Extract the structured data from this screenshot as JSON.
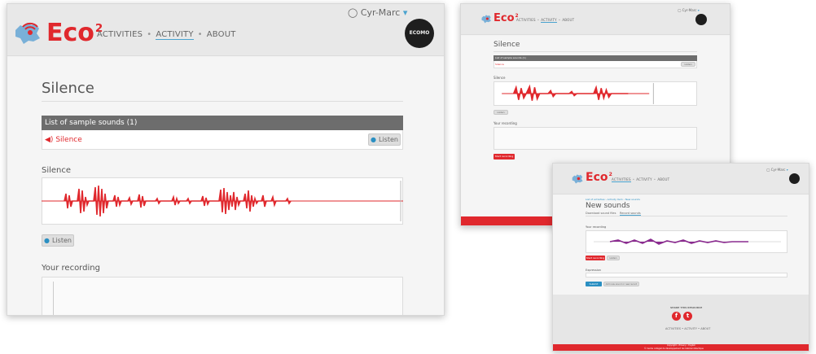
{
  "brand": {
    "name": "Eco",
    "sup": "2",
    "badge": "ECOMO",
    "color": "#e0282d"
  },
  "nav": {
    "items": [
      "ACTIVITIES",
      "ACTIVITY",
      "ABOUT"
    ],
    "separator": "•"
  },
  "user": {
    "name": "Cyr-Marc",
    "caret": "▾"
  },
  "main": {
    "title": "Silence",
    "panel_title": "List of sample sounds (1)",
    "sound_name": "Silence",
    "listen": "Listen",
    "waveform_title": "Silence",
    "recording_title": "Your recording",
    "start_recording": "Start recording"
  },
  "third": {
    "breadcrumb": "List of activities › Activity item › New sounds",
    "title": "New sounds",
    "tabs": [
      "Download sound files",
      "Record sounds"
    ],
    "recording_title": "Your recording",
    "start_recording": "Start recording",
    "listen": "Listen",
    "expression_label": "Expression",
    "submit": "Submit",
    "secondary": "Add new sound or new record",
    "share_title": "SHARE THIS RESOURCE",
    "social": [
      "f",
      "t"
    ],
    "footer_nav": [
      "ACTIVITIES",
      "ACTIVITY",
      "ABOUT"
    ],
    "footer_links": "Copyright  •  Privacy  •  English",
    "footer_copy": "© Centre collégial de développement de matériel didactique"
  },
  "icons": {
    "user": "user-icon",
    "speaker": "speaker-icon",
    "play": "play-icon"
  }
}
